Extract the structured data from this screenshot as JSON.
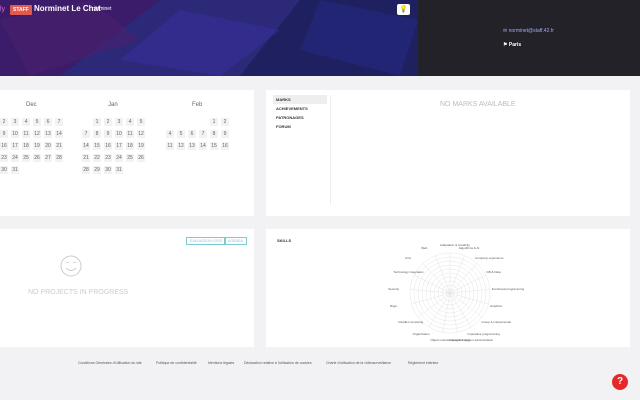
{
  "header": {
    "brand_fragment": "ly",
    "staff_badge": "STAFF",
    "user_name": "Norminet Le Chat",
    "user_login": "norminet",
    "email": "norminet@staff.42.fr",
    "city": "Paris",
    "bulb_icon": "lightbulb-icon"
  },
  "calendar": {
    "months": [
      "Dec",
      "Jan",
      "Feb"
    ],
    "dec": [
      [
        "2",
        "3",
        "4",
        "5",
        "6",
        "7"
      ],
      [
        "9",
        "10",
        "11",
        "12",
        "13",
        "14"
      ],
      [
        "16",
        "17",
        "18",
        "19",
        "20",
        "21"
      ],
      [
        "23",
        "24",
        "25",
        "26",
        "27",
        "28"
      ],
      [
        "30",
        "31"
      ]
    ],
    "jan": [
      [
        "1",
        "2",
        "3",
        "4",
        "5"
      ],
      [
        "7",
        "8",
        "9",
        "10",
        "11",
        "12"
      ],
      [
        "14",
        "15",
        "16",
        "17",
        "18",
        "19"
      ],
      [
        "21",
        "22",
        "23",
        "24",
        "25",
        "26"
      ],
      [
        "28",
        "29",
        "30",
        "31"
      ]
    ],
    "feb": [
      [
        "1",
        "2"
      ],
      [
        "4",
        "5",
        "6",
        "7",
        "8",
        "9"
      ],
      [
        "11",
        "12",
        "13",
        "14",
        "15",
        "16"
      ]
    ]
  },
  "marks": {
    "tabs": [
      "MARKS",
      "ACHIEVEMENTS",
      "PATRONAGES",
      "FORUM"
    ],
    "empty_text": "NO MARKS AVAILABLE"
  },
  "projects": {
    "evaluation_btn": "EVALUATION LOGS",
    "agenda_btn": "AGENDA",
    "empty_text": "No projects in progress"
  },
  "skills": {
    "title": "SKILLS",
    "labels": [
      "Adaptation & creativity",
      "Algorithms & AI",
      "Company experience",
      "DB & Data",
      "Functional programming",
      "Graphics",
      "Group & interpersonal",
      "Imperative programming",
      "Network & system administration",
      "Object-oriented programming",
      "Organization",
      "Parallel computing",
      "Rigor",
      "Security",
      "Technology integration",
      "Unix",
      "Web"
    ]
  },
  "footer": {
    "links": [
      "Conditions Générales d'Utilisation du site",
      "Politique de confidentialité",
      "Mentions légales",
      "Déclaration relative à l'utilisation de cookies",
      "Charte d'utilisation de la vidéosurveillance",
      "Règlement intérieur"
    ],
    "help": "?"
  }
}
